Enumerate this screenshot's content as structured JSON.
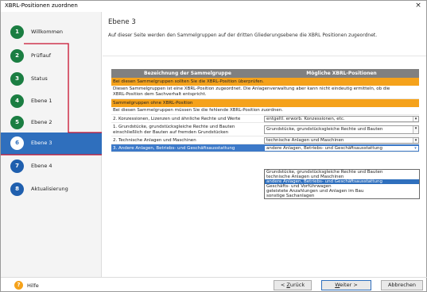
{
  "window": {
    "title": "XBRL-Positionen zuordnen",
    "close_glyph": "×"
  },
  "sidebar": {
    "items": [
      {
        "number": "1",
        "label": "Willkommen"
      },
      {
        "number": "2",
        "label": "Prüflauf"
      },
      {
        "number": "3",
        "label": "Status"
      },
      {
        "number": "4",
        "label": "Ebene 1"
      },
      {
        "number": "5",
        "label": "Ebene 2"
      },
      {
        "number": "6",
        "label": "Ebene 3"
      },
      {
        "number": "7",
        "label": "Ebene 4"
      },
      {
        "number": "8",
        "label": "Aktualisierung"
      }
    ],
    "active_index": 5
  },
  "main": {
    "title": "Ebene 3",
    "description": "Auf dieser Seite werden den Sammelgruppen auf der dritten Gliederungsebene die XBRL Positionen zugeordnet.",
    "table": {
      "headers": [
        "Bezeichnung der Sammelgruppe",
        "Mögliche XBRL-Positionen"
      ],
      "section1_title": "Bei diesen Sammelgruppen sollten Sie die XBRL-Position überprüfen.",
      "section1_note_line1": "Diesen Sammelgruppen ist eine XBRL-Position zugeordnet. Die Anlagenverwaltung aber kann nicht eindeutig ermitteln, ob die",
      "section1_note_line2": "XBRL-Position dem Sachverhalt entspricht.",
      "section2_title": "Sammelgruppen ohne XBRL-Position",
      "section2_note": "Bei diesen Sammelgruppen müssen Sie die fehlende XBRL-Position zuordnen.",
      "rows": [
        {
          "name": "2. Konzessionen, Lizenzen und ähnliche Rechte und Werte",
          "value": "entgeltl. erworb. Konzessionen, etc."
        },
        {
          "name_line1": "1. Grundstücke, grundstücksgleiche Rechte und Bauten",
          "name_line2": "einschließlich der Bauten auf fremden Grundstücken",
          "value": "Grundstücke, grundstücksgleiche Rechte und Bauten"
        },
        {
          "name": "2. Technische  Anlagen und Maschinen",
          "value": "technische Anlagen und Maschinen"
        },
        {
          "name": "3. Andere Anlagen, Betriebs- und Geschäftsausstattung",
          "value": "andere Anlagen, Betriebs- und Geschäftsausstattung"
        }
      ],
      "arrow_glyph": "▾",
      "dropdown_options": [
        "Grundstücke, grundstücksgleiche Rechte und Bauten",
        "technische Anlagen und Maschinen",
        "andere Anlagen, Betriebs- und Geschäftsausstattung",
        "Geschäfts- und Vorführwagen",
        "geleistete Anzahlungen und Anlagen im Bau",
        "sonstige Sachanlagen"
      ],
      "dropdown_highlight_index": 2
    }
  },
  "footer": {
    "help_glyph": "?",
    "help_label": "Hilfe",
    "back_label_prefix": "< ",
    "back_label_ul": "Z",
    "back_label_rest": "urück",
    "next_label_ul": "W",
    "next_label_rest": "eiter >",
    "cancel_label": "Abbrechen"
  },
  "colors": {
    "step_green": "#1b7e42",
    "step_blue": "#1f5fae",
    "active_bg": "#2f6fbd",
    "orange": "#f5a21b",
    "selected_row": "#3c79c8"
  }
}
